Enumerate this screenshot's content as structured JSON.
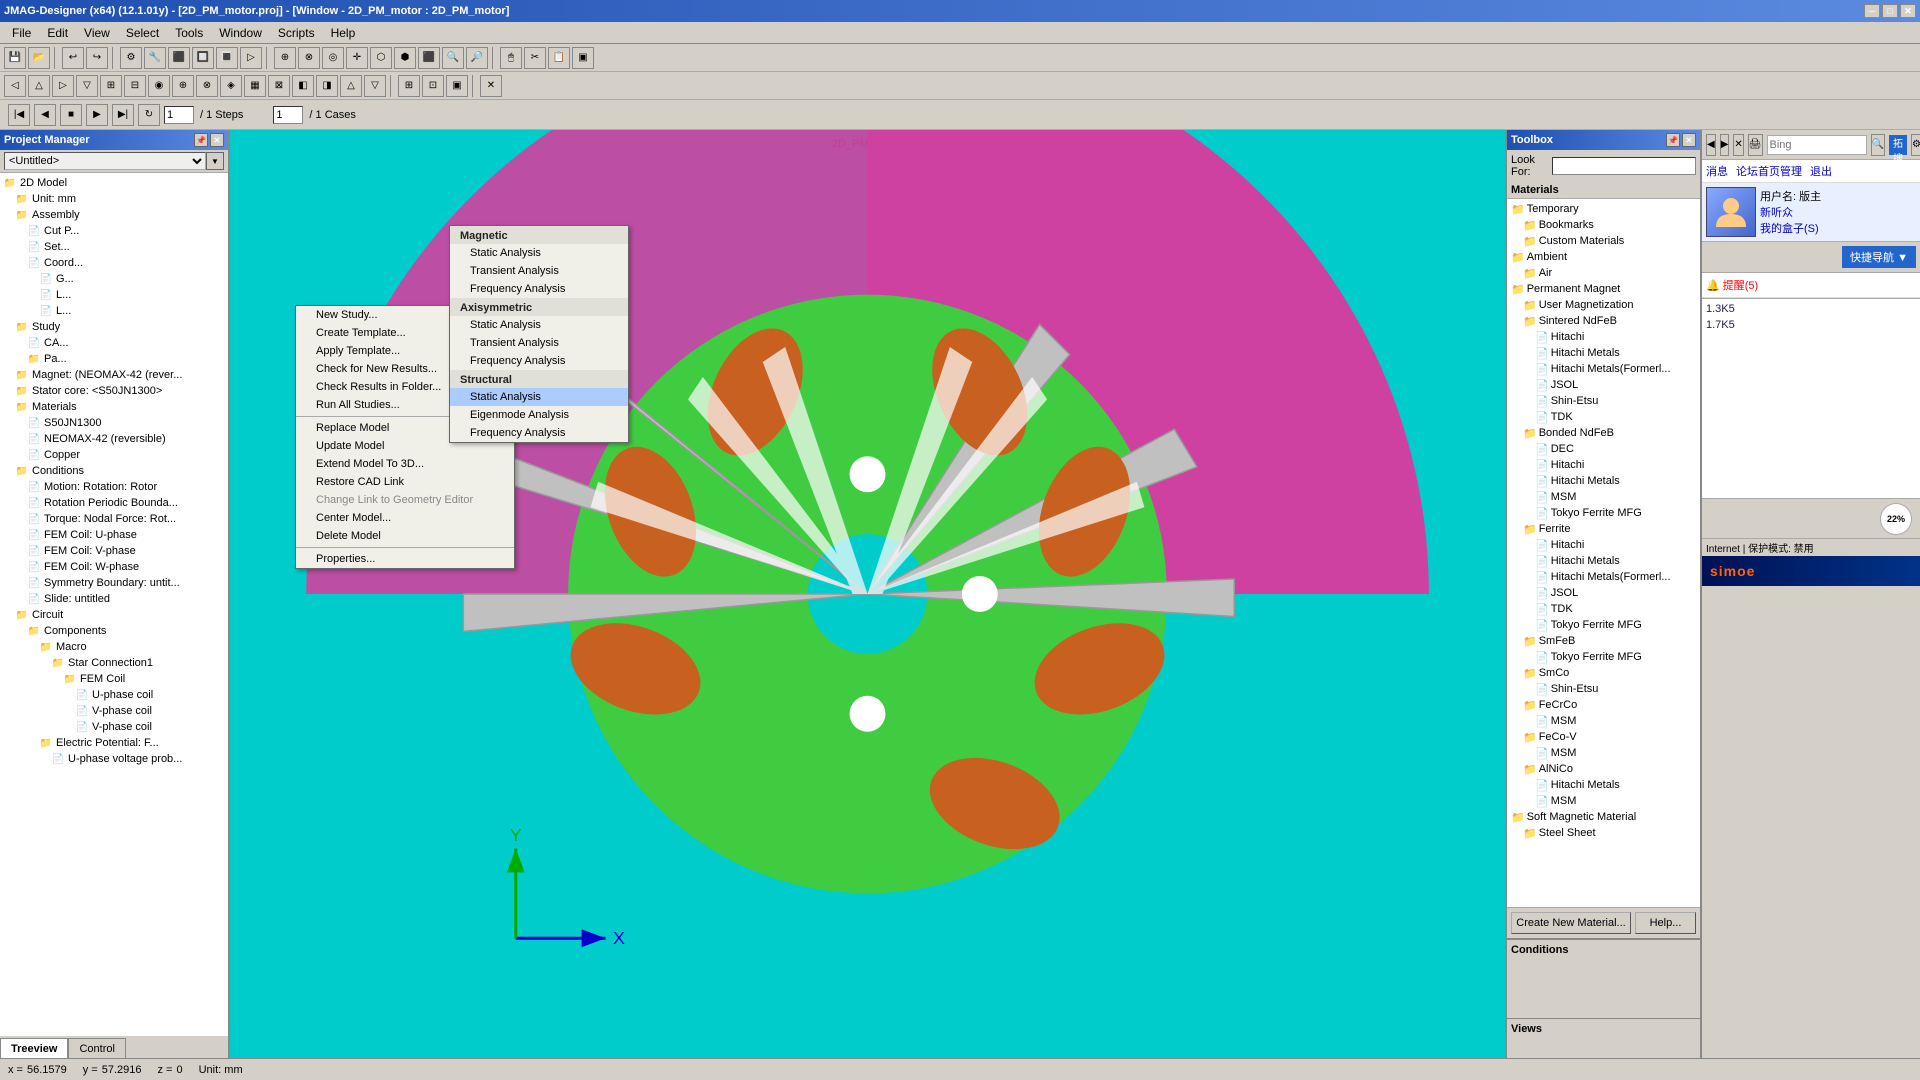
{
  "titlebar": {
    "title": "JMAG-Designer (x64) (12.1.01y) - [2D_PM_motor.proj] - [Window - 2D_PM_motor : 2D_PM_motor]",
    "min": "─",
    "max": "□",
    "close": "✕"
  },
  "menubar": {
    "items": [
      "File",
      "Edit",
      "View",
      "Select",
      "Tools",
      "Window",
      "Scripts",
      "Help"
    ]
  },
  "toolbar": {
    "items": []
  },
  "nav": {
    "steps_label": "/ 1 Steps",
    "cases_label": "/ 1 Cases"
  },
  "project_manager": {
    "title": "Project Manager",
    "project_label": "Project: <Untitled>"
  },
  "tree": {
    "items": [
      {
        "level": 0,
        "icon": "📁",
        "label": "2D Model"
      },
      {
        "level": 1,
        "icon": "📁",
        "label": "Unit: mm"
      },
      {
        "level": 1,
        "icon": "📁",
        "label": "Assembly"
      },
      {
        "level": 2,
        "icon": "📄",
        "label": "Cut P..."
      },
      {
        "level": 2,
        "icon": "📄",
        "label": "Set..."
      },
      {
        "level": 2,
        "icon": "📄",
        "label": "Coord..."
      },
      {
        "level": 3,
        "icon": "📄",
        "label": "G..."
      },
      {
        "level": 3,
        "icon": "📄",
        "label": "L..."
      },
      {
        "level": 3,
        "icon": "📄",
        "label": "L..."
      },
      {
        "level": 1,
        "icon": "📁",
        "label": "Study"
      },
      {
        "level": 2,
        "icon": "📄",
        "label": "CA..."
      },
      {
        "level": 2,
        "icon": "📁",
        "label": "Pa..."
      },
      {
        "level": 1,
        "icon": "📁",
        "label": "Magnet: (NEOMAX-42 (rever..."
      },
      {
        "level": 1,
        "icon": "📁",
        "label": "Stator core: <S50JN1300>"
      },
      {
        "level": 1,
        "icon": "📁",
        "label": "Materials"
      },
      {
        "level": 2,
        "icon": "📄",
        "label": "S50JN1300"
      },
      {
        "level": 2,
        "icon": "📄",
        "label": "NEOMAX-42 (reversible)"
      },
      {
        "level": 2,
        "icon": "📄",
        "label": "Copper"
      },
      {
        "level": 1,
        "icon": "📁",
        "label": "Conditions"
      },
      {
        "level": 2,
        "icon": "📄",
        "label": "Motion: Rotation: Rotor"
      },
      {
        "level": 2,
        "icon": "📄",
        "label": "Rotation Periodic Bounda..."
      },
      {
        "level": 2,
        "icon": "📄",
        "label": "Torque: Nodal Force: Rot..."
      },
      {
        "level": 2,
        "icon": "📄",
        "label": "FEM Coil: U-phase"
      },
      {
        "level": 2,
        "icon": "📄",
        "label": "FEM Coil: V-phase"
      },
      {
        "level": 2,
        "icon": "📄",
        "label": "FEM Coil: W-phase"
      },
      {
        "level": 2,
        "icon": "📄",
        "label": "Symmetry Boundary: untit..."
      },
      {
        "level": 2,
        "icon": "📄",
        "label": "Slide: untitled"
      },
      {
        "level": 1,
        "icon": "📁",
        "label": "Circuit"
      },
      {
        "level": 2,
        "icon": "📁",
        "label": "Components"
      },
      {
        "level": 3,
        "icon": "📁",
        "label": "Macro"
      },
      {
        "level": 4,
        "icon": "📁",
        "label": "Star Connection1"
      },
      {
        "level": 5,
        "icon": "📁",
        "label": "FEM Coil"
      },
      {
        "level": 6,
        "icon": "📄",
        "label": "U-phase coil"
      },
      {
        "level": 6,
        "icon": "📄",
        "label": "V-phase coil"
      },
      {
        "level": 6,
        "icon": "📄",
        "label": "V-phase coil"
      },
      {
        "level": 3,
        "icon": "📁",
        "label": "Electric Potential: F..."
      },
      {
        "level": 4,
        "icon": "📄",
        "label": "U-phase voltage prob..."
      }
    ]
  },
  "context_menu": {
    "items": [
      {
        "label": "New Study...",
        "arrow": true,
        "disabled": false
      },
      {
        "label": "Create Template...",
        "arrow": false,
        "disabled": false
      },
      {
        "label": "Apply Template...",
        "arrow": false,
        "disabled": false
      },
      {
        "label": "Check for New Results...",
        "arrow": false,
        "disabled": false
      },
      {
        "label": "Check Results in Folder...",
        "arrow": false,
        "disabled": false
      },
      {
        "label": "Run All Studies...",
        "arrow": false,
        "disabled": false
      },
      {
        "label": "sep"
      },
      {
        "label": "Replace Model",
        "arrow": false,
        "disabled": false
      },
      {
        "label": "Update Model",
        "arrow": false,
        "disabled": false
      },
      {
        "label": "Extend Model To 3D...",
        "arrow": false,
        "disabled": false
      },
      {
        "label": "Restore CAD Link",
        "arrow": false,
        "disabled": false
      },
      {
        "label": "Change Link to Geometry Editor",
        "arrow": false,
        "disabled": true
      },
      {
        "label": "Center Model...",
        "arrow": false,
        "disabled": false
      },
      {
        "label": "Delete Model",
        "arrow": false,
        "disabled": false
      },
      {
        "label": "sep"
      },
      {
        "label": "Properties...",
        "arrow": false,
        "disabled": false
      }
    ]
  },
  "submenu": {
    "sections": [
      {
        "header": "Magnetic",
        "items": [
          {
            "label": "Static Analysis",
            "selected": false
          },
          {
            "label": "Transient Analysis",
            "selected": false
          },
          {
            "label": "Frequency Analysis",
            "selected": false
          }
        ]
      },
      {
        "header": "Axisymmetric",
        "items": [
          {
            "label": "Static Analysis",
            "selected": false
          },
          {
            "label": "Transient Analysis",
            "selected": false
          },
          {
            "label": "Frequency Analysis",
            "selected": false
          }
        ]
      },
      {
        "header": "Structural",
        "items": [
          {
            "label": "Static Analysis",
            "selected": true
          },
          {
            "label": "Eigenmode Analysis",
            "selected": false
          },
          {
            "label": "Frequency Analysis",
            "selected": false
          }
        ]
      }
    ]
  },
  "canvas": {
    "label": "2D_PM_motor"
  },
  "toolbox": {
    "title": "Toolbox",
    "look_for_label": "Look For:",
    "materials_label": "Materials",
    "materials_tree": [
      {
        "level": 0,
        "label": "Temporary"
      },
      {
        "level": 1,
        "label": "Bookmarks"
      },
      {
        "level": 1,
        "label": "Custom Materials"
      },
      {
        "level": 0,
        "label": "Ambient"
      },
      {
        "level": 1,
        "label": "Air"
      },
      {
        "level": 0,
        "label": "Permanent Magnet"
      },
      {
        "level": 1,
        "label": "User Magnetization"
      },
      {
        "level": 1,
        "label": "Sintered NdFeB"
      },
      {
        "level": 2,
        "label": "Hitachi"
      },
      {
        "level": 2,
        "label": "Hitachi Metals"
      },
      {
        "level": 2,
        "label": "Hitachi Metals(Formerl..."
      },
      {
        "level": 2,
        "label": "JSOL"
      },
      {
        "level": 2,
        "label": "Shin-Etsu"
      },
      {
        "level": 2,
        "label": "TDK"
      },
      {
        "level": 1,
        "label": "Bonded NdFeB"
      },
      {
        "level": 2,
        "label": "DEC"
      },
      {
        "level": 2,
        "label": "Hitachi"
      },
      {
        "level": 2,
        "label": "Hitachi Metals"
      },
      {
        "level": 2,
        "label": "MSM"
      },
      {
        "level": 2,
        "label": "Tokyo Ferrite MFG"
      },
      {
        "level": 1,
        "label": "Ferrite"
      },
      {
        "level": 2,
        "label": "Hitachi"
      },
      {
        "level": 2,
        "label": "Hitachi Metals"
      },
      {
        "level": 2,
        "label": "Hitachi Metals(Formerl..."
      },
      {
        "level": 2,
        "label": "JSOL"
      },
      {
        "level": 2,
        "label": "TDK"
      },
      {
        "level": 2,
        "label": "Tokyo Ferrite MFG"
      },
      {
        "level": 1,
        "label": "SmFeB"
      },
      {
        "level": 2,
        "label": "Tokyo Ferrite MFG"
      },
      {
        "level": 1,
        "label": "SmCo"
      },
      {
        "level": 2,
        "label": "Shin-Etsu"
      },
      {
        "level": 1,
        "label": "FeCrCo"
      },
      {
        "level": 2,
        "label": "MSM"
      },
      {
        "level": 1,
        "label": "FeCo-V"
      },
      {
        "level": 2,
        "label": "MSM"
      },
      {
        "level": 1,
        "label": "AlNiCo"
      },
      {
        "level": 2,
        "label": "Hitachi Metals"
      },
      {
        "level": 2,
        "label": "MSM"
      },
      {
        "level": 0,
        "label": "Soft Magnetic Material"
      },
      {
        "level": 1,
        "label": "Steel Sheet"
      }
    ],
    "create_btn": "Create New Material...",
    "help_btn": "Help...",
    "conditions_label": "Conditions",
    "views_label": "Views"
  },
  "status_bar": {
    "x_label": "x =",
    "x_val": "56.1579",
    "y_label": "y =",
    "y_val": "57.2916",
    "z_label": "z =",
    "z_val": "0",
    "unit": "Unit: mm"
  },
  "tabs": {
    "items": [
      "Treeview",
      "Control"
    ]
  },
  "browser": {
    "bing_placeholder": "Bing",
    "upload_btn": "拓搜上传",
    "menu_items": [
      "消息",
      "论坛首页管理",
      "退出"
    ],
    "username": "用户名: 版主",
    "new_user": "新听众",
    "my_box": "我的盒子(S)",
    "quick_btn": "快捷导航 ▼",
    "msg_label": "消息",
    "msg_count": "提醒(5)",
    "chat": [
      {
        "text": "1.3K5"
      },
      {
        "text": "1.7K5"
      }
    ],
    "pct": "22%",
    "ie_label": "Internet | 保护模式: 禁用",
    "simoe_logo": "simoe"
  }
}
